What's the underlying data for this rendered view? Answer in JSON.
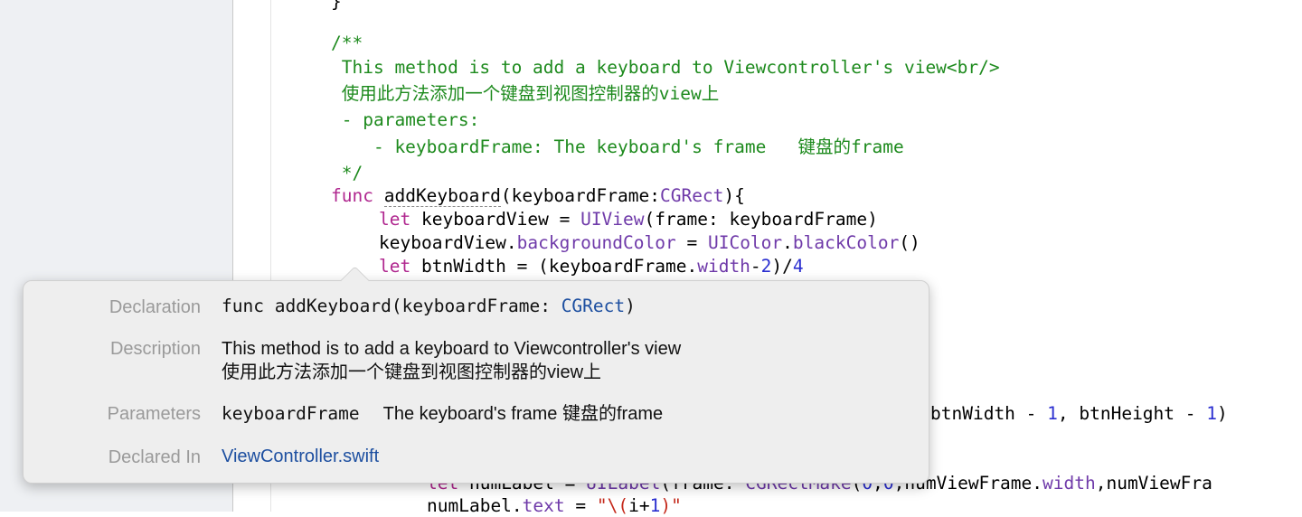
{
  "code": {
    "line0": "}",
    "doc_open": "/**",
    "doc_line1": " This method is to add a keyboard to Viewcontroller's view<br/>",
    "doc_line2": " 使用此方法添加一个键盘到视图控制器的view上",
    "doc_line3": " - parameters:",
    "doc_line4": "    - keyboardFrame: The keyboard's frame   键盘的frame",
    "doc_close": " */",
    "func_kw": "func",
    "func_name": "addKeyboard",
    "func_params_a": "(keyboardFrame:",
    "func_type": "CGRect",
    "func_params_b": "){",
    "l1_kw": "let",
    "l1_a": " keyboardView = ",
    "l1_type": "UIView",
    "l1_b": "(frame: keyboardFrame)",
    "l2_a": "keyboardView.",
    "l2_prop": "backgroundColor",
    "l2_b": " = ",
    "l2_type": "UIColor",
    "l2_c": ".",
    "l2_method": "blackColor",
    "l2_d": "()",
    "l3_kw": "let",
    "l3_a": " btnWidth = (keyboardFrame.",
    "l3_prop": "width",
    "l3_b": "-",
    "l3_n1": "2",
    "l3_c": ")/",
    "l3_n2": "4",
    "l4_a": "btnWidth - ",
    "l4_n1": "1",
    "l4_b": ", btnHeight - ",
    "l4_n2": "1",
    "l4_c": ")",
    "l5_kw": "let",
    "l5_a": " numLabel = ",
    "l5_type": "UILabel",
    "l5_b": "(frame: ",
    "l5_fn": "CGRectMake",
    "l5_c": "(",
    "l5_n1": "0",
    "l5_d": ",",
    "l5_n2": "0",
    "l5_e": ",numViewFrame.",
    "l5_prop": "width",
    "l5_f": ",numViewFra",
    "l6_a": "numLabel.",
    "l6_prop": "text",
    "l6_b": " = ",
    "l6_str1": "\"\\(",
    "l6_c": "i+",
    "l6_n": "1",
    "l6_str2": ")\""
  },
  "quick_help": {
    "declaration_label": "Declaration",
    "declaration_a": "func addKeyboard(keyboardFrame: ",
    "declaration_type": "CGRect",
    "declaration_b": ")",
    "description_label": "Description",
    "description_line1": "This method is to add a keyboard to Viewcontroller's view",
    "description_line2": "使用此方法添加一个键盘到视图控制器的view上",
    "parameters_label": "Parameters",
    "parameter_name": "keyboardFrame",
    "parameter_desc": "The keyboard's frame 键盘的frame",
    "declared_in_label": "Declared In",
    "declared_in_file": "ViewController.swift"
  }
}
